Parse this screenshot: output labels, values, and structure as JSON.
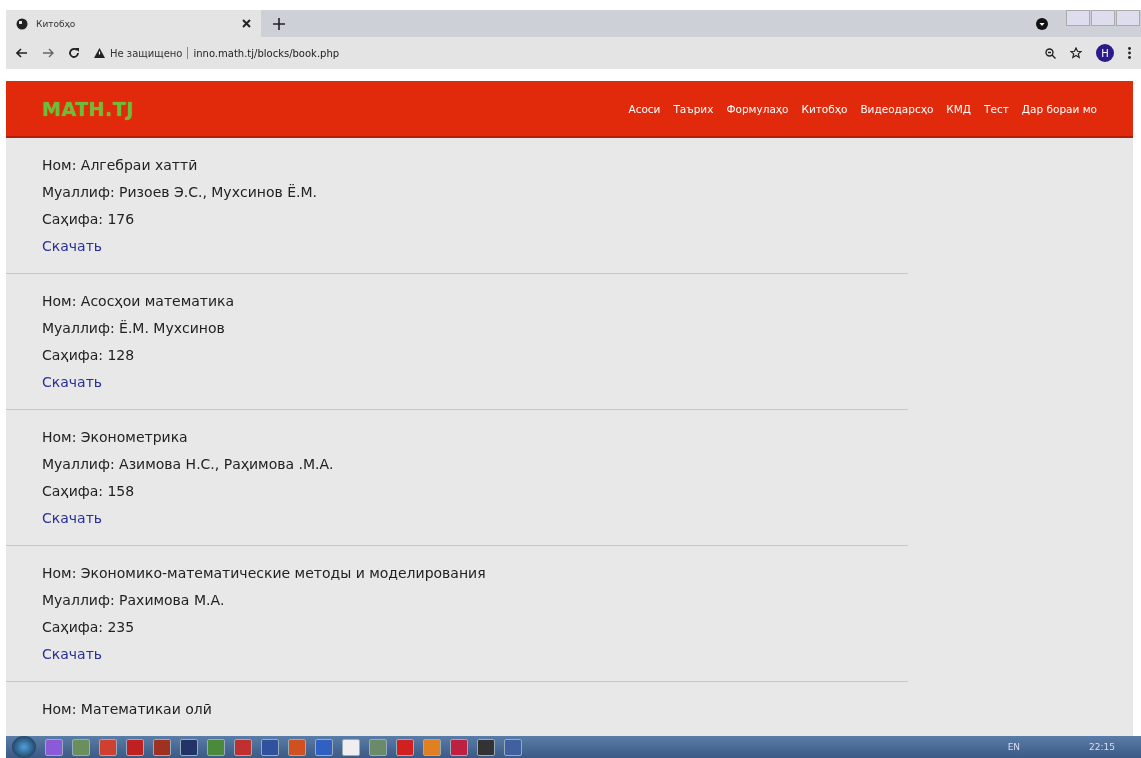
{
  "browser": {
    "tab_title": "Китобҳо",
    "security": "Не защищено",
    "url": "inno.math.tj/blocks/book.php",
    "profile": "H"
  },
  "site": {
    "logo": "MATH.TJ",
    "nav": [
      {
        "label": "Асоси"
      },
      {
        "label": "Таърих"
      },
      {
        "label": "Формулаҳо"
      },
      {
        "label": "Китобҳо"
      },
      {
        "label": "Видеодарсҳо"
      },
      {
        "label": "КМД"
      },
      {
        "label": "Тест"
      },
      {
        "label": "Дар бораи мо"
      }
    ]
  },
  "books": [
    {
      "title": "Ном: Алгебраи хаттӣ",
      "author": "Муаллиф: Ризоев Э.С., Мухсинов Ё.М.",
      "pages": "Саҳифа: 176",
      "link": "Скачать"
    },
    {
      "title": "Ном: Асосҳои математика",
      "author": "Муаллиф: Ё.М. Мухсинов",
      "pages": "Саҳифа: 128",
      "link": "Скачать"
    },
    {
      "title": "Ном: Эконометрика",
      "author": "Муаллиф: Азимова Н.С., Раҳимова .М.А.",
      "pages": "Саҳифа: 158",
      "link": "Скачать"
    },
    {
      "title": "Ном: Экономико-математические методы и моделирования",
      "author": "Муаллиф: Рахимова М.А.",
      "pages": "Саҳифа: 235",
      "link": "Скачать"
    },
    {
      "title": "Ном: Математикаи олӣ"
    }
  ],
  "taskbar": {
    "language": "EN",
    "clock": "22:15"
  }
}
